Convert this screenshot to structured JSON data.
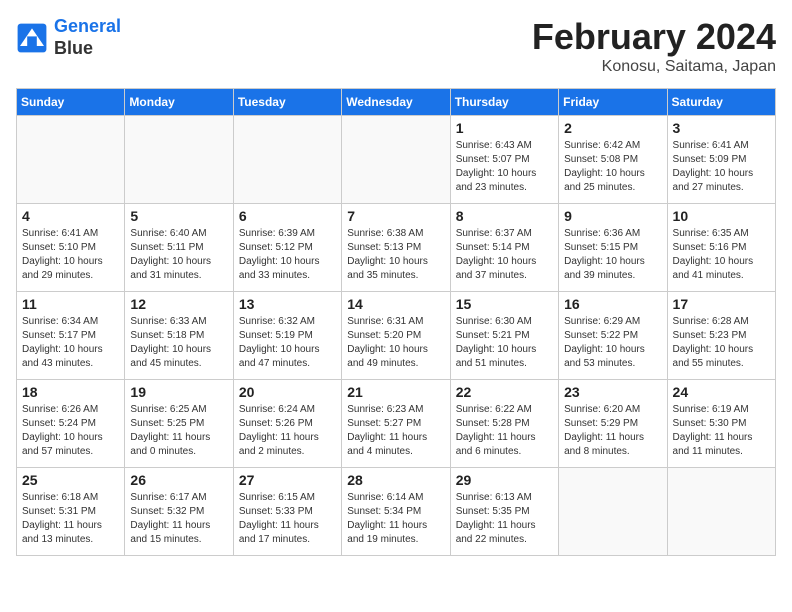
{
  "logo": {
    "line1": "General",
    "line2": "Blue"
  },
  "title": "February 2024",
  "location": "Konosu, Saitama, Japan",
  "days_of_week": [
    "Sunday",
    "Monday",
    "Tuesday",
    "Wednesday",
    "Thursday",
    "Friday",
    "Saturday"
  ],
  "weeks": [
    [
      {
        "day": "",
        "info": ""
      },
      {
        "day": "",
        "info": ""
      },
      {
        "day": "",
        "info": ""
      },
      {
        "day": "",
        "info": ""
      },
      {
        "day": "1",
        "info": "Sunrise: 6:43 AM\nSunset: 5:07 PM\nDaylight: 10 hours\nand 23 minutes."
      },
      {
        "day": "2",
        "info": "Sunrise: 6:42 AM\nSunset: 5:08 PM\nDaylight: 10 hours\nand 25 minutes."
      },
      {
        "day": "3",
        "info": "Sunrise: 6:41 AM\nSunset: 5:09 PM\nDaylight: 10 hours\nand 27 minutes."
      }
    ],
    [
      {
        "day": "4",
        "info": "Sunrise: 6:41 AM\nSunset: 5:10 PM\nDaylight: 10 hours\nand 29 minutes."
      },
      {
        "day": "5",
        "info": "Sunrise: 6:40 AM\nSunset: 5:11 PM\nDaylight: 10 hours\nand 31 minutes."
      },
      {
        "day": "6",
        "info": "Sunrise: 6:39 AM\nSunset: 5:12 PM\nDaylight: 10 hours\nand 33 minutes."
      },
      {
        "day": "7",
        "info": "Sunrise: 6:38 AM\nSunset: 5:13 PM\nDaylight: 10 hours\nand 35 minutes."
      },
      {
        "day": "8",
        "info": "Sunrise: 6:37 AM\nSunset: 5:14 PM\nDaylight: 10 hours\nand 37 minutes."
      },
      {
        "day": "9",
        "info": "Sunrise: 6:36 AM\nSunset: 5:15 PM\nDaylight: 10 hours\nand 39 minutes."
      },
      {
        "day": "10",
        "info": "Sunrise: 6:35 AM\nSunset: 5:16 PM\nDaylight: 10 hours\nand 41 minutes."
      }
    ],
    [
      {
        "day": "11",
        "info": "Sunrise: 6:34 AM\nSunset: 5:17 PM\nDaylight: 10 hours\nand 43 minutes."
      },
      {
        "day": "12",
        "info": "Sunrise: 6:33 AM\nSunset: 5:18 PM\nDaylight: 10 hours\nand 45 minutes."
      },
      {
        "day": "13",
        "info": "Sunrise: 6:32 AM\nSunset: 5:19 PM\nDaylight: 10 hours\nand 47 minutes."
      },
      {
        "day": "14",
        "info": "Sunrise: 6:31 AM\nSunset: 5:20 PM\nDaylight: 10 hours\nand 49 minutes."
      },
      {
        "day": "15",
        "info": "Sunrise: 6:30 AM\nSunset: 5:21 PM\nDaylight: 10 hours\nand 51 minutes."
      },
      {
        "day": "16",
        "info": "Sunrise: 6:29 AM\nSunset: 5:22 PM\nDaylight: 10 hours\nand 53 minutes."
      },
      {
        "day": "17",
        "info": "Sunrise: 6:28 AM\nSunset: 5:23 PM\nDaylight: 10 hours\nand 55 minutes."
      }
    ],
    [
      {
        "day": "18",
        "info": "Sunrise: 6:26 AM\nSunset: 5:24 PM\nDaylight: 10 hours\nand 57 minutes."
      },
      {
        "day": "19",
        "info": "Sunrise: 6:25 AM\nSunset: 5:25 PM\nDaylight: 11 hours\nand 0 minutes."
      },
      {
        "day": "20",
        "info": "Sunrise: 6:24 AM\nSunset: 5:26 PM\nDaylight: 11 hours\nand 2 minutes."
      },
      {
        "day": "21",
        "info": "Sunrise: 6:23 AM\nSunset: 5:27 PM\nDaylight: 11 hours\nand 4 minutes."
      },
      {
        "day": "22",
        "info": "Sunrise: 6:22 AM\nSunset: 5:28 PM\nDaylight: 11 hours\nand 6 minutes."
      },
      {
        "day": "23",
        "info": "Sunrise: 6:20 AM\nSunset: 5:29 PM\nDaylight: 11 hours\nand 8 minutes."
      },
      {
        "day": "24",
        "info": "Sunrise: 6:19 AM\nSunset: 5:30 PM\nDaylight: 11 hours\nand 11 minutes."
      }
    ],
    [
      {
        "day": "25",
        "info": "Sunrise: 6:18 AM\nSunset: 5:31 PM\nDaylight: 11 hours\nand 13 minutes."
      },
      {
        "day": "26",
        "info": "Sunrise: 6:17 AM\nSunset: 5:32 PM\nDaylight: 11 hours\nand 15 minutes."
      },
      {
        "day": "27",
        "info": "Sunrise: 6:15 AM\nSunset: 5:33 PM\nDaylight: 11 hours\nand 17 minutes."
      },
      {
        "day": "28",
        "info": "Sunrise: 6:14 AM\nSunset: 5:34 PM\nDaylight: 11 hours\nand 19 minutes."
      },
      {
        "day": "29",
        "info": "Sunrise: 6:13 AM\nSunset: 5:35 PM\nDaylight: 11 hours\nand 22 minutes."
      },
      {
        "day": "",
        "info": ""
      },
      {
        "day": "",
        "info": ""
      }
    ]
  ]
}
